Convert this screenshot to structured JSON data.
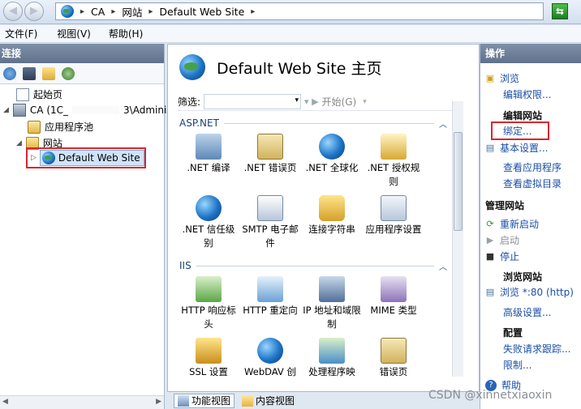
{
  "address": {
    "crumbs": [
      "CA",
      "网站",
      "Default Web Site"
    ]
  },
  "menu": [
    "文件(F)",
    "视图(V)",
    "帮助(H)"
  ],
  "left": {
    "header": "连接",
    "tree": {
      "start_page": "起始页",
      "server": "CA (1C_",
      "server_suffix": "3\\Adminis",
      "app_pools": "应用程序池",
      "sites": "网站",
      "selected_site": "Default Web Site"
    }
  },
  "center": {
    "title": "Default Web Site 主页",
    "filter_label": "筛选:",
    "start_label": "开始(G)",
    "groups": [
      {
        "name": "ASP.NET",
        "tiles": [
          ".NET 编译",
          ".NET 错误页",
          ".NET 全球化",
          ".NET 授权规则",
          ".NET 信任级别",
          "SMTP 电子邮件",
          "连接字符串",
          "应用程序设置"
        ]
      },
      {
        "name": "IIS",
        "tiles": [
          "HTTP 响应标头",
          "HTTP 重定向",
          "IP 地址和域限制",
          "MIME 类型",
          "SSL 设置",
          "WebDAV 创",
          "处理程序映",
          "错误页"
        ]
      }
    ],
    "tabs": [
      "功能视图",
      "内容视图"
    ]
  },
  "right": {
    "header": "操作",
    "browse": "浏览",
    "edit_perms": "编辑权限...",
    "edit_site_title": "编辑网站",
    "bind": "绑定...",
    "basic": "基本设置...",
    "view_apps": "查看应用程序",
    "view_vdirs": "查看虚拟目录",
    "manage_title": "管理网站",
    "restart": "重新启动",
    "start": "启动",
    "stop": "停止",
    "browse_site_title": "浏览网站",
    "browse_port": "浏览 *:80 (http)",
    "advanced": "高级设置...",
    "config_title": "配置",
    "failed_trace": "失败请求跟踪...",
    "limits": "限制...",
    "help": "帮助"
  },
  "watermark": "CSDN @xinnetxiaoxin",
  "icons": [
    "back-arrow-icon",
    "forward-arrow-icon",
    "globe-icon",
    "refresh-icon",
    "chevron-icon",
    "save-icon",
    "folder-up-icon",
    "disconnect-icon"
  ]
}
